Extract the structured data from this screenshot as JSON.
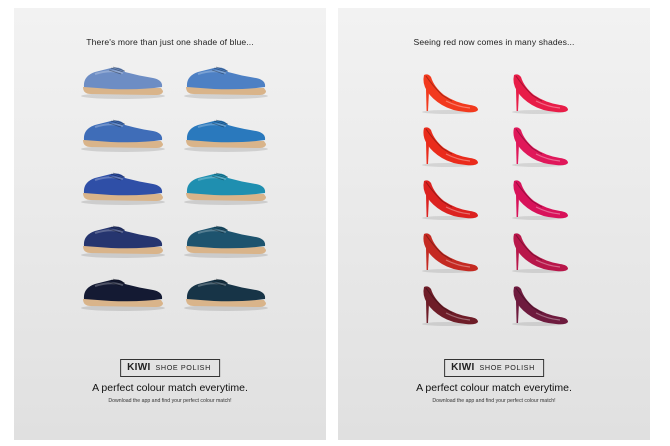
{
  "left_poster": {
    "headline": "There's more than just one shade of blue...",
    "brand": "KIWI",
    "product": "SHOE POLISH",
    "tagline": "A perfect colour match everytime.",
    "subline": "Download the app and find your perfect colour match!",
    "shoe_colors_left": [
      "#6d8dc4",
      "#3f6db8",
      "#2f4fa7",
      "#26356f",
      "#141a33"
    ],
    "shoe_colors_right": [
      "#4d80c4",
      "#2a79bd",
      "#1f8fb0",
      "#1d536e",
      "#173447"
    ]
  },
  "right_poster": {
    "headline": "Seeing red now comes in many shades...",
    "brand": "KIWI",
    "product": "SHOE POLISH",
    "tagline": "A perfect colour match everytime.",
    "subline": "Download the app and find your perfect colour match!",
    "heel_colors_left": [
      "#f23a1e",
      "#ea2b1b",
      "#dc2220",
      "#c42a22",
      "#6e1d28"
    ],
    "heel_colors_right": [
      "#e81d48",
      "#e0175a",
      "#d8125a",
      "#b8174a",
      "#6e1b3e"
    ]
  }
}
